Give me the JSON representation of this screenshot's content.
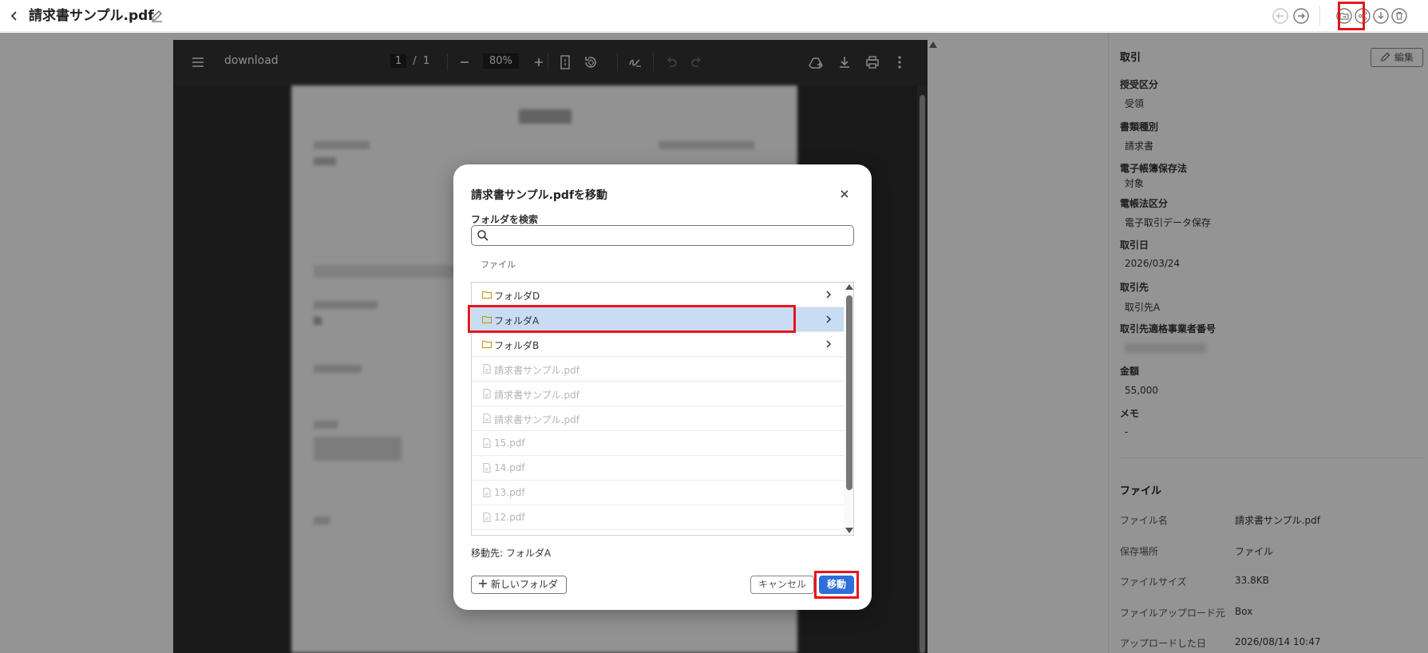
{
  "header": {
    "back_icon": "chevron-left-icon",
    "title": "請求書サンプル.pdf",
    "edit_icon": "pencil-icon",
    "actions": [
      "arrow-left-circle-icon",
      "arrow-right-circle-icon",
      "move-folder-icon",
      "share-icon",
      "download-circle-icon",
      "trash-icon"
    ]
  },
  "viewer": {
    "file_name": "download",
    "page_current": "1",
    "page_separator": "/",
    "page_total": "1",
    "zoom": "80%"
  },
  "transaction": {
    "section_title": "取引",
    "edit_label": "編集",
    "fields": [
      {
        "label": "授受区分",
        "value": "受領"
      },
      {
        "label": "書類種別",
        "value": "請求書"
      },
      {
        "label": "電子帳簿保存法",
        "value": "対象"
      },
      {
        "label": "電帳法区分",
        "value": "電子取引データ保存"
      },
      {
        "label": "取引日",
        "value": "2026/03/24"
      },
      {
        "label": "取引先",
        "value": "取引先A"
      },
      {
        "label": "取引先適格事業者番号",
        "value": ""
      },
      {
        "label": "金額",
        "value": "55,000"
      },
      {
        "label": "メモ",
        "value": "-"
      }
    ]
  },
  "file_info": {
    "section_title": "ファイル",
    "fields": [
      {
        "label": "ファイル名",
        "value": "請求書サンプル.pdf"
      },
      {
        "label": "保存場所",
        "value": "ファイル"
      },
      {
        "label": "ファイルサイズ",
        "value": "33.8KB"
      },
      {
        "label": "ファイルアップロード元",
        "value": "Box"
      },
      {
        "label": "アップロードした日",
        "value": "2026/08/14 10:47"
      }
    ]
  },
  "dialog": {
    "title": "請求書サンプル.pdfを移動",
    "search_label": "フォルダを検索",
    "search_value": "",
    "breadcrumb": "ファイル",
    "items": [
      {
        "label": "フォルダD",
        "type": "folder"
      },
      {
        "label": "フォルダA",
        "type": "folder",
        "selected": true
      },
      {
        "label": "フォルダB",
        "type": "folder"
      },
      {
        "label": "請求書サンプル.pdf",
        "type": "file"
      },
      {
        "label": "請求書サンプル.pdf",
        "type": "file"
      },
      {
        "label": "請求書サンプル.pdf",
        "type": "file"
      },
      {
        "label": "15.pdf",
        "type": "file"
      },
      {
        "label": "14.pdf",
        "type": "file"
      },
      {
        "label": "13.pdf",
        "type": "file"
      },
      {
        "label": "12.pdf",
        "type": "file"
      }
    ],
    "destination": "移動先: フォルダA",
    "new_folder_label": "新しいフォルダ",
    "cancel_label": "キャンセル",
    "move_label": "移動"
  },
  "colors": {
    "highlight": "#e8141c",
    "primary": "#2e6fd9",
    "selected_row": "#c8dcf3",
    "folder": "#c99a2e"
  }
}
